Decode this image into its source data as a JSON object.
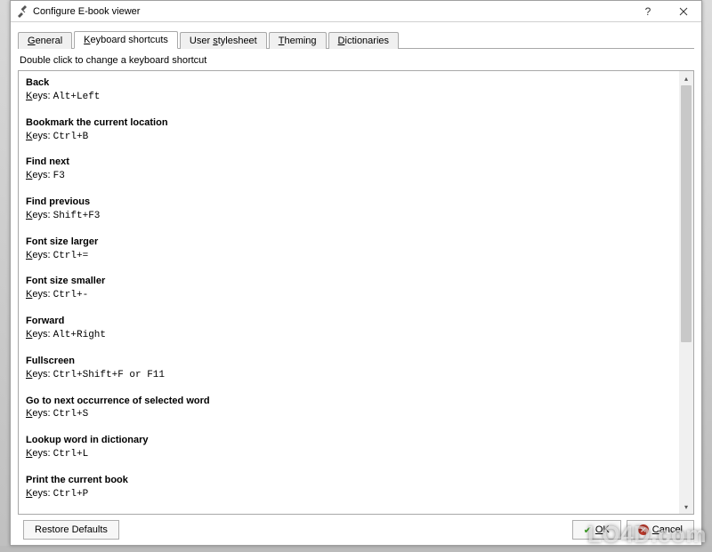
{
  "window": {
    "title": "Configure E-book viewer"
  },
  "tabs": [
    {
      "label_pre": "",
      "label_u": "G",
      "label_post": "eneral"
    },
    {
      "label_pre": "",
      "label_u": "K",
      "label_post": "eyboard shortcuts"
    },
    {
      "label_pre": "User ",
      "label_u": "s",
      "label_post": "tylesheet"
    },
    {
      "label_pre": "",
      "label_u": "T",
      "label_post": "heming"
    },
    {
      "label_pre": "",
      "label_u": "D",
      "label_post": "ictionaries"
    }
  ],
  "hint": "Double click to change a keyboard shortcut",
  "keys_label": "Keys",
  "shortcuts": [
    {
      "title": "Back",
      "keys": "Alt+Left"
    },
    {
      "title": "Bookmark the current location",
      "keys": "Ctrl+B"
    },
    {
      "title": "Find next",
      "keys": "F3"
    },
    {
      "title": "Find previous",
      "keys": "Shift+F3"
    },
    {
      "title": "Font size larger",
      "keys": "Ctrl+="
    },
    {
      "title": "Font size smaller",
      "keys": "Ctrl+-"
    },
    {
      "title": "Forward",
      "keys": "Alt+Right"
    },
    {
      "title": "Fullscreen",
      "keys": "Ctrl+Shift+F or F11"
    },
    {
      "title": "Go to next occurrence of selected word",
      "keys": "Ctrl+S"
    },
    {
      "title": "Lookup word in dictionary",
      "keys": "Ctrl+L"
    },
    {
      "title": "Print the current book",
      "keys": "Ctrl+P"
    }
  ],
  "buttons": {
    "restore": "Restore Defaults",
    "ok_u": "O",
    "ok_post": "K",
    "cancel_pre": "",
    "cancel_u": "C",
    "cancel_post": "ancel"
  },
  "watermark": "LO4D.com"
}
